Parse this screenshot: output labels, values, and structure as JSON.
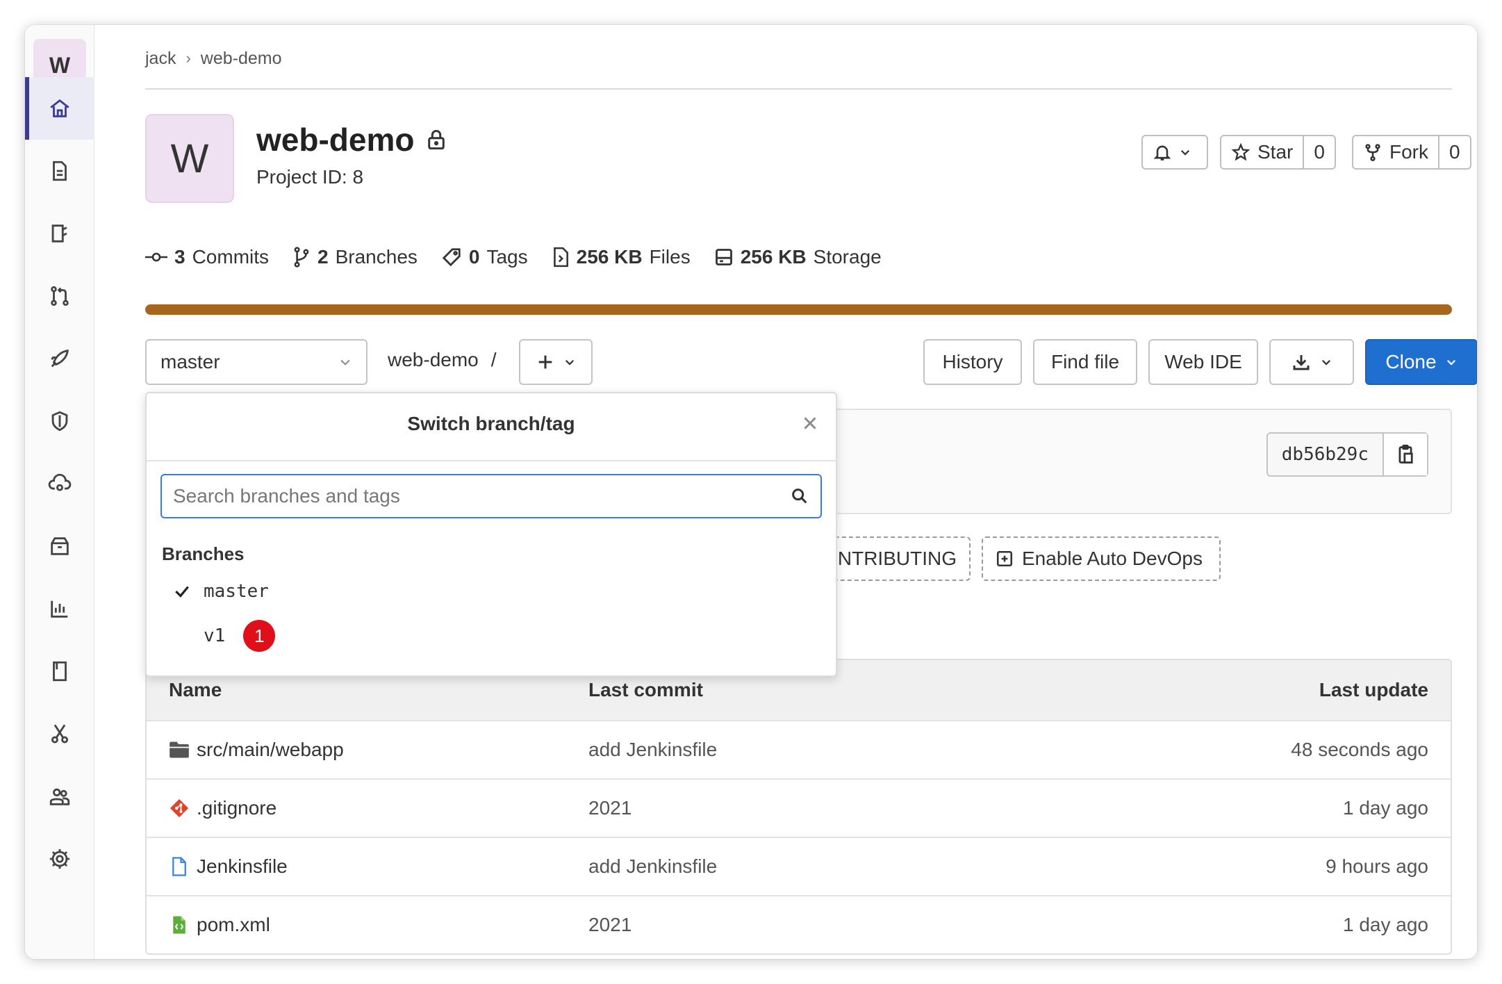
{
  "sidebar": {
    "avatar_letter": "W",
    "items": [
      {
        "name": "project-overview",
        "icon": "home-icon",
        "active": true
      },
      {
        "name": "repository",
        "icon": "document-icon"
      },
      {
        "name": "issues",
        "icon": "issues-icon"
      },
      {
        "name": "merge-requests",
        "icon": "merge-request-icon"
      },
      {
        "name": "ci-cd",
        "icon": "rocket-icon"
      },
      {
        "name": "security",
        "icon": "shield-icon"
      },
      {
        "name": "deployments",
        "icon": "cloud-icon"
      },
      {
        "name": "packages",
        "icon": "package-icon"
      },
      {
        "name": "analytics",
        "icon": "chart-icon"
      },
      {
        "name": "wiki",
        "icon": "book-icon"
      },
      {
        "name": "snippets",
        "icon": "scissors-icon"
      },
      {
        "name": "members",
        "icon": "users-icon"
      },
      {
        "name": "settings",
        "icon": "gear-icon"
      }
    ]
  },
  "breadcrumb": {
    "owner": "jack",
    "separator": "›",
    "project": "web-demo"
  },
  "project": {
    "avatar_letter": "W",
    "name": "web-demo",
    "id_label": "Project ID: 8"
  },
  "header_buttons": {
    "star_label": "Star",
    "star_count": "0",
    "fork_label": "Fork",
    "fork_count": "0"
  },
  "stats": {
    "commits_count": "3",
    "commits_label": "Commits",
    "branches_count": "2",
    "branches_label": "Branches",
    "tags_count": "0",
    "tags_label": "Tags",
    "files_size": "256 KB",
    "files_label": "Files",
    "storage_size": "256 KB",
    "storage_label": "Storage"
  },
  "colors": {
    "language_bar": "#a8651c",
    "clone_button": "#1f6fd0",
    "badge": "#e0101a",
    "active_nav": "#3b3b94"
  },
  "toolbar": {
    "branch": "master",
    "path_root": "web-demo",
    "path_sep": "/",
    "history": "History",
    "find_file": "Find file",
    "web_ide": "Web IDE",
    "clone": "Clone"
  },
  "commit": {
    "sha": "db56b29c"
  },
  "quick_actions": {
    "contributing": "CONTRIBUTING",
    "auto_devops": "Enable Auto DevOps"
  },
  "dropdown": {
    "title": "Switch branch/tag",
    "search_placeholder": "Search branches and tags",
    "section": "Branches",
    "branches": [
      {
        "name": "master",
        "selected": true
      },
      {
        "name": "v1",
        "selected": false,
        "badge": "1"
      }
    ]
  },
  "table": {
    "headers": {
      "name": "Name",
      "last_commit": "Last commit",
      "last_update": "Last update"
    },
    "rows": [
      {
        "name": "src/main/webapp",
        "icon": "folder-icon",
        "commit": "add Jenkinsfile",
        "updated": "48 seconds ago"
      },
      {
        "name": ".gitignore",
        "icon": "git-file-icon",
        "commit": "2021",
        "updated": "1 day ago"
      },
      {
        "name": "Jenkinsfile",
        "icon": "file-icon",
        "commit": "add Jenkinsfile",
        "updated": "9 hours ago"
      },
      {
        "name": "pom.xml",
        "icon": "xml-file-icon",
        "commit": "2021",
        "updated": "1 day ago"
      }
    ]
  }
}
